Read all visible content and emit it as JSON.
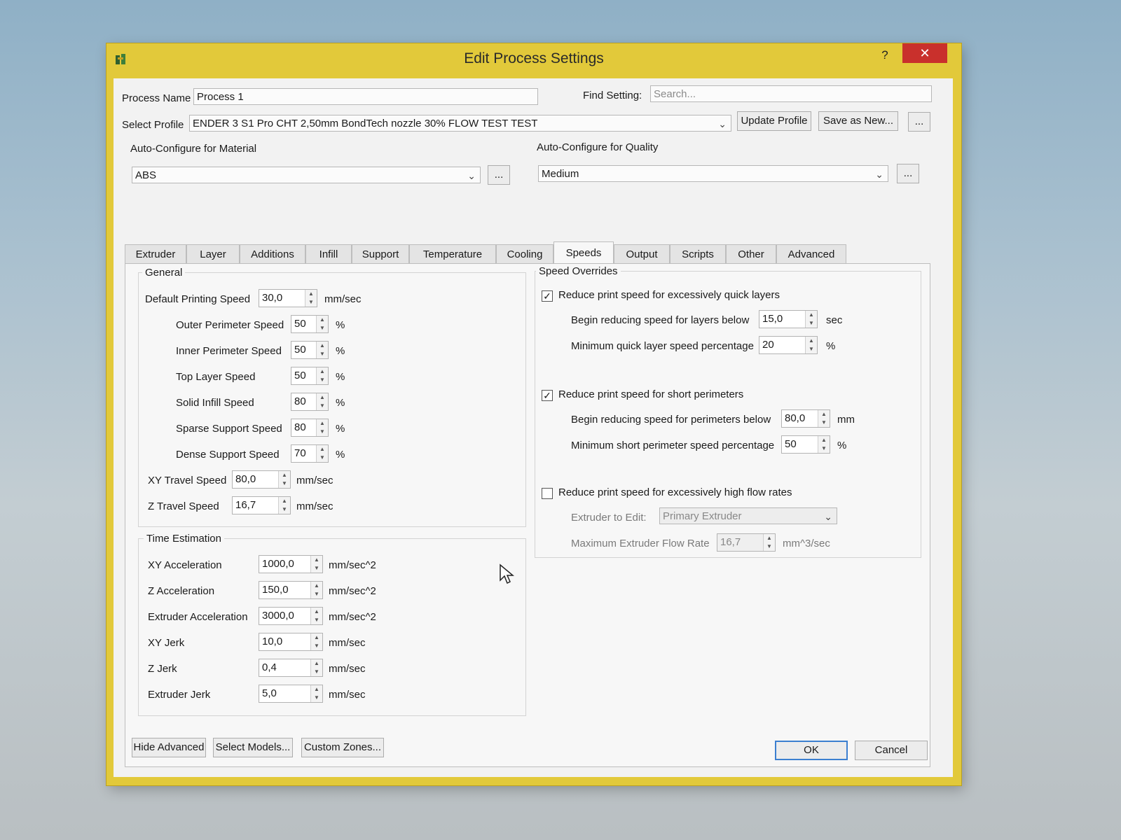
{
  "window": {
    "title": "Edit Process Settings",
    "help": "?",
    "close": "✕"
  },
  "top": {
    "process_name_label": "Process Name",
    "process_name_value": "Process 1",
    "find_setting_label": "Find Setting:",
    "search_placeholder": "Search...",
    "select_profile_label": "Select Profile",
    "profile_value": "ENDER 3 S1 Pro CHT 2,50mm BondTech nozzle 30% FLOW TEST TEST",
    "update_profile": "Update Profile",
    "save_as_new": "Save as New...",
    "more": "...",
    "material_label": "Auto-Configure for Material",
    "material_value": "ABS",
    "quality_label": "Auto-Configure for Quality",
    "quality_value": "Medium"
  },
  "tabs": [
    "Extruder",
    "Layer",
    "Additions",
    "Infill",
    "Support",
    "Temperature",
    "Cooling",
    "Speeds",
    "Output",
    "Scripts",
    "Other",
    "Advanced"
  ],
  "active_tab": "Speeds",
  "general": {
    "title": "General",
    "default_speed": {
      "label": "Default Printing Speed",
      "value": "30,0",
      "unit": "mm/sec"
    },
    "rows": [
      {
        "label": "Outer Perimeter Speed",
        "value": "50",
        "unit": "%"
      },
      {
        "label": "Inner Perimeter Speed",
        "value": "50",
        "unit": "%"
      },
      {
        "label": "Top Layer Speed",
        "value": "50",
        "unit": "%"
      },
      {
        "label": "Solid Infill Speed",
        "value": "80",
        "unit": "%"
      },
      {
        "label": "Sparse Support Speed",
        "value": "80",
        "unit": "%"
      },
      {
        "label": "Dense Support Speed",
        "value": "70",
        "unit": "%"
      }
    ],
    "xy_travel": {
      "label": "XY Travel Speed",
      "value": "80,0",
      "unit": "mm/sec"
    },
    "z_travel": {
      "label": "Z Travel Speed",
      "value": "16,7",
      "unit": "mm/sec"
    }
  },
  "time_estimation": {
    "title": "Time Estimation",
    "rows": [
      {
        "label": "XY Acceleration",
        "value": "1000,0",
        "unit": "mm/sec^2"
      },
      {
        "label": "Z Acceleration",
        "value": "150,0",
        "unit": "mm/sec^2"
      },
      {
        "label": "Extruder Acceleration",
        "value": "3000,0",
        "unit": "mm/sec^2"
      },
      {
        "label": "XY Jerk",
        "value": "10,0",
        "unit": "mm/sec"
      },
      {
        "label": "Z Jerk",
        "value": "0,4",
        "unit": "mm/sec"
      },
      {
        "label": "Extruder Jerk",
        "value": "5,0",
        "unit": "mm/sec"
      }
    ]
  },
  "overrides": {
    "title": "Speed Overrides",
    "quick_layers": {
      "label": "Reduce print speed for excessively quick layers",
      "checked": true,
      "begin": {
        "label": "Begin reducing speed for layers below",
        "value": "15,0",
        "unit": "sec"
      },
      "min": {
        "label": "Minimum quick layer speed percentage",
        "value": "20",
        "unit": "%"
      }
    },
    "short_perimeters": {
      "label": "Reduce print speed for short perimeters",
      "checked": true,
      "begin": {
        "label": "Begin reducing speed for perimeters below",
        "value": "80,0",
        "unit": "mm"
      },
      "min": {
        "label": "Minimum short perimeter speed percentage",
        "value": "50",
        "unit": "%"
      }
    },
    "high_flow": {
      "label": "Reduce print speed for excessively high flow rates",
      "checked": false,
      "extruder_label": "Extruder to Edit:",
      "extruder_value": "Primary Extruder",
      "max_flow": {
        "label": "Maximum Extruder Flow Rate",
        "value": "16,7",
        "unit": "mm^3/sec"
      }
    }
  },
  "bottom": {
    "hide_advanced": "Hide Advanced",
    "select_models": "Select Models...",
    "custom_zones": "Custom Zones...",
    "ok": "OK",
    "cancel": "Cancel"
  },
  "colors": {
    "title_bar": "#e2c93a",
    "close_button": "#c9302c",
    "ok_border": "#3c7fd0"
  }
}
